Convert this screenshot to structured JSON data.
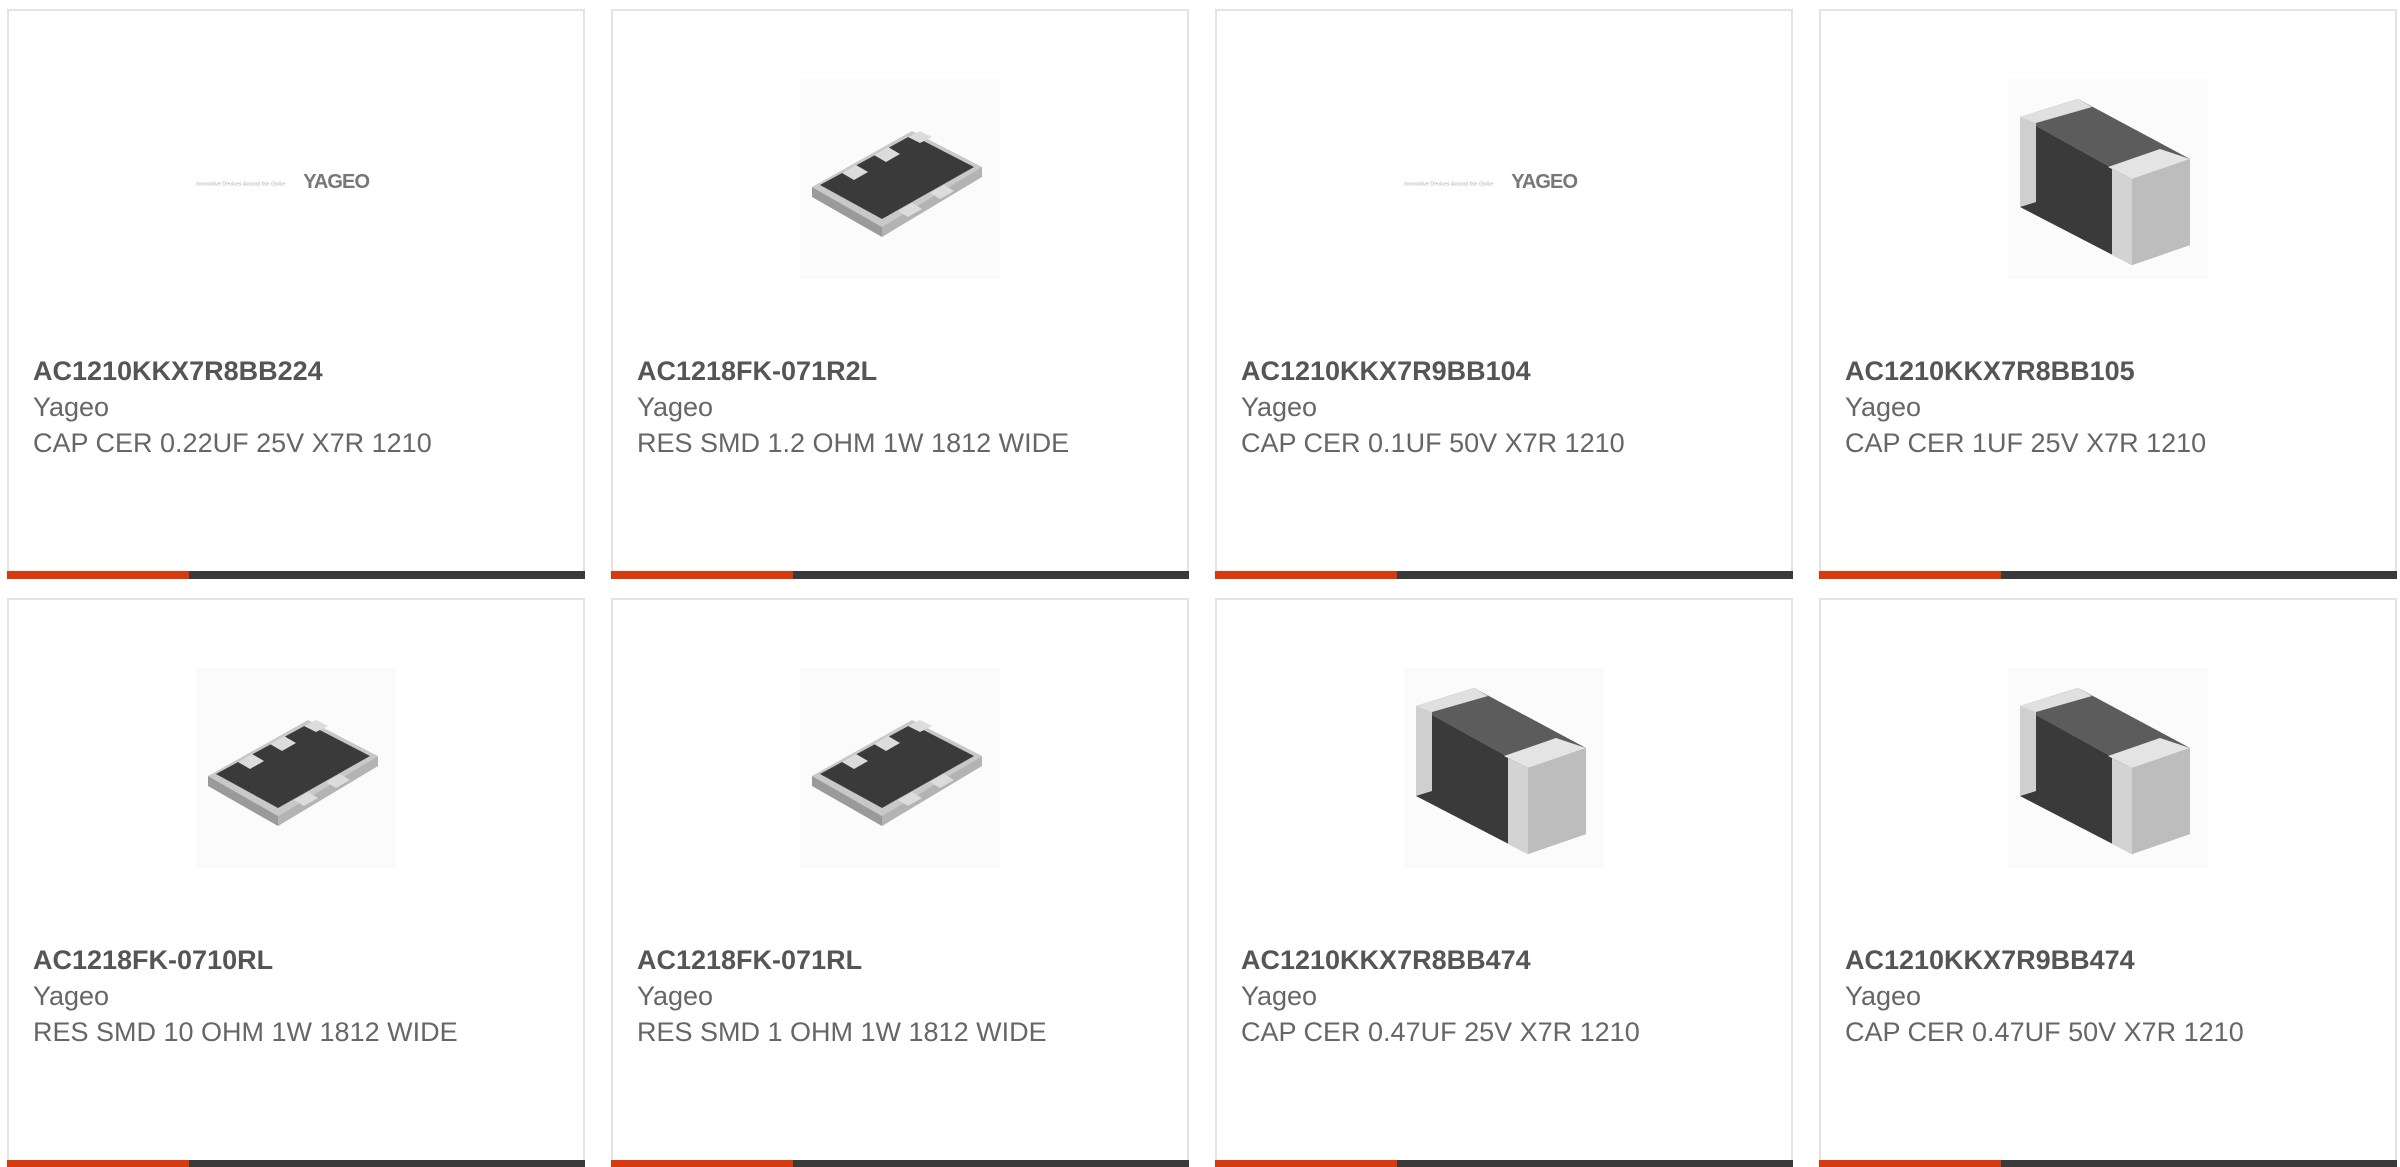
{
  "colors": {
    "accent": "#d83a0e",
    "bar": "#3a3a3a",
    "border": "#e3e3e3",
    "text": "#666666"
  },
  "products": [
    {
      "part_number": "AC1210KKX7R8BB224",
      "manufacturer": "Yageo",
      "description": "CAP CER 0.22UF 25V X7R 1210",
      "image": "yageo-logo"
    },
    {
      "part_number": "AC1218FK-071R2L",
      "manufacturer": "Yageo",
      "description": "RES SMD 1.2 OHM 1W 1812 WIDE",
      "image": "resistor-array-chip"
    },
    {
      "part_number": "AC1210KKX7R9BB104",
      "manufacturer": "Yageo",
      "description": "CAP CER 0.1UF 50V X7R 1210",
      "image": "yageo-logo"
    },
    {
      "part_number": "AC1210KKX7R8BB105",
      "manufacturer": "Yageo",
      "description": "CAP CER 1UF 25V X7R 1210",
      "image": "capacitor-chip"
    },
    {
      "part_number": "AC1218FK-0710RL",
      "manufacturer": "Yageo",
      "description": "RES SMD 10 OHM 1W 1812 WIDE",
      "image": "resistor-array-chip"
    },
    {
      "part_number": "AC1218FK-071RL",
      "manufacturer": "Yageo",
      "description": "RES SMD 1 OHM 1W 1812 WIDE",
      "image": "resistor-array-chip"
    },
    {
      "part_number": "AC1210KKX7R8BB474",
      "manufacturer": "Yageo",
      "description": "CAP CER 0.47UF 25V X7R 1210",
      "image": "capacitor-chip"
    },
    {
      "part_number": "AC1210KKX7R9BB474",
      "manufacturer": "Yageo",
      "description": "CAP CER 0.47UF 50V X7R 1210",
      "image": "capacitor-chip"
    }
  ],
  "logo": {
    "brand": "YAGEO",
    "tagline": "Innovative Devices Around the Globe"
  }
}
